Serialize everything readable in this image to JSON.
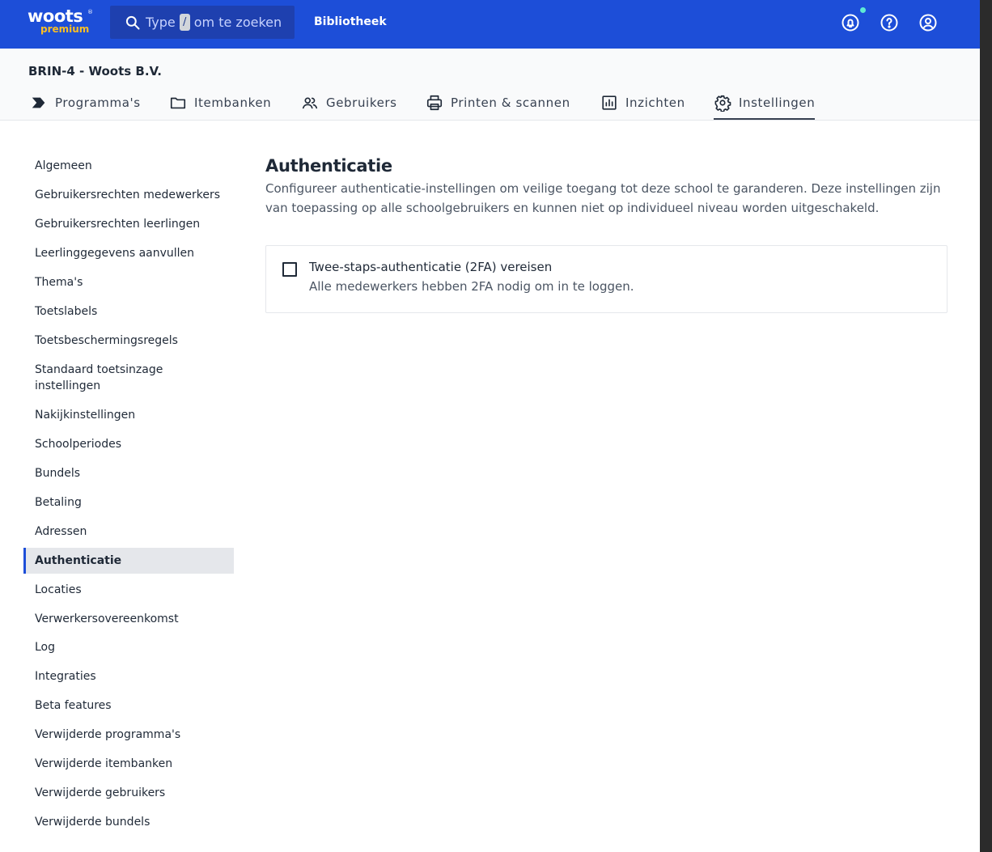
{
  "brand": {
    "name": "woots",
    "tier": "premium",
    "trademark": "®",
    "accent_color": "#1d4ed8",
    "tier_color": "#fbbf24"
  },
  "search": {
    "prefix": "Type",
    "shortcut": "/",
    "suffix": "om te zoeken",
    "icon": "search-icon"
  },
  "topnav": {
    "library_label": "Bibliotheek"
  },
  "top_icons": [
    "notifications-icon",
    "help-icon",
    "account-icon"
  ],
  "org": {
    "title": "BRIN-4 - Woots B.V."
  },
  "tabs": [
    {
      "label": "Programma's",
      "icon": "programs-icon",
      "active": false
    },
    {
      "label": "Itembanken",
      "icon": "folder-icon",
      "active": false
    },
    {
      "label": "Gebruikers",
      "icon": "users-icon",
      "active": false
    },
    {
      "label": "Printen & scannen",
      "icon": "printer-icon",
      "active": false
    },
    {
      "label": "Inzichten",
      "icon": "chart-icon",
      "active": false
    },
    {
      "label": "Instellingen",
      "icon": "gear-icon",
      "active": true
    }
  ],
  "sidebar": {
    "items": [
      {
        "label": "Algemeen"
      },
      {
        "label": "Gebruikersrechten medewerkers"
      },
      {
        "label": "Gebruikersrechten leerlingen"
      },
      {
        "label": "Leerlinggegevens aanvullen"
      },
      {
        "label": "Thema's"
      },
      {
        "label": "Toetslabels"
      },
      {
        "label": "Toetsbeschermingsregels"
      },
      {
        "label": "Standaard toetsinzage instellingen"
      },
      {
        "label": "Nakijkinstellingen"
      },
      {
        "label": "Schoolperiodes"
      },
      {
        "label": "Bundels"
      },
      {
        "label": "Betaling"
      },
      {
        "label": "Adressen"
      },
      {
        "label": "Authenticatie",
        "active": true
      },
      {
        "label": "Locaties"
      },
      {
        "label": "Verwerkersovereenkomst"
      },
      {
        "label": "Log"
      },
      {
        "label": "Integraties"
      },
      {
        "label": "Beta features"
      },
      {
        "label": "Verwijderde programma's"
      },
      {
        "label": "Verwijderde itembanken"
      },
      {
        "label": "Verwijderde gebruikers"
      },
      {
        "label": "Verwijderde bundels"
      }
    ]
  },
  "main": {
    "title": "Authenticatie",
    "description": "Configureer authenticatie-instellingen om veilige toegang tot deze school te garanderen. Deze instellingen zijn van toepassing op alle schoolgebruikers en kunnen niet op individueel niveau worden uitgeschakeld.",
    "settings": [
      {
        "label": "Twee-staps-authenticatie (2FA) vereisen",
        "help": "Alle medewerkers hebben 2FA nodig om in te loggen.",
        "checked": false
      }
    ]
  }
}
